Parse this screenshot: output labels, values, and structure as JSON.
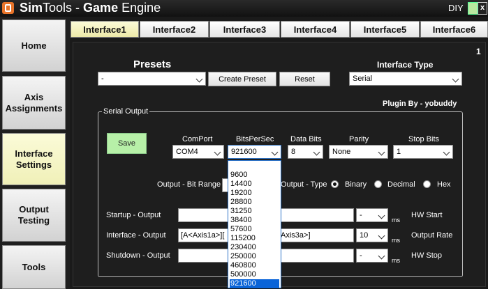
{
  "window": {
    "title_light": "Sim",
    "title_bold": "Tools",
    "title_sep": " - ",
    "title_game": "Game",
    "title_engine": " Engine",
    "diy": "DIY",
    "close": "x"
  },
  "nav": {
    "home": "Home",
    "axis_1": "Axis",
    "axis_2": "Assignments",
    "interface_1": "Interface",
    "interface_2": "Settings",
    "output_1": "Output",
    "output_2": "Testing",
    "tools": "Tools"
  },
  "tabs": [
    "Interface1",
    "Interface2",
    "Interface3",
    "Interface4",
    "Interface5",
    "Interface6"
  ],
  "panel": {
    "number": "1",
    "presets_title": "Presets",
    "presets_value": "-",
    "create_preset": "Create Preset",
    "reset": "Reset",
    "interface_type_title": "Interface Type",
    "interface_type_value": "Serial",
    "plugin_by": "Plugin By - yobuddy"
  },
  "serial": {
    "group_title": "Serial Output",
    "save": "Save",
    "comport_label": "ComPort",
    "comport_value": "COM4",
    "bps_label": "BitsPerSec",
    "bps_value": "921600",
    "databits_label": "Data Bits",
    "databits_value": "8",
    "parity_label": "Parity",
    "parity_value": "None",
    "stopbits_label": "Stop Bits",
    "stopbits_value": "1",
    "bit_range_label": "Output - Bit Range",
    "output_type_label": "Output - Type",
    "type_binary": "Binary",
    "type_decimal": "Decimal",
    "type_hex": "Hex",
    "startup_label": "Startup - Output",
    "startup_value": "",
    "startup_ms_value": "-",
    "ms": "ms",
    "hw_start": "HW Start",
    "interface_label": "Interface - Output",
    "interface_value_left": "[A<Axis1a>][",
    "interface_value_right": "Axis3a>]",
    "interface_rate_value": "10",
    "output_rate": "Output Rate",
    "shutdown_label": "Shutdown - Output",
    "shutdown_value": "",
    "shutdown_ms_value": "-",
    "hw_stop": "HW Stop"
  },
  "bps_options": [
    "9600",
    "14400",
    "19200",
    "28800",
    "31250",
    "38400",
    "57600",
    "115200",
    "230400",
    "250000",
    "460800",
    "500000",
    "921600"
  ],
  "bps_selected": "921600"
}
